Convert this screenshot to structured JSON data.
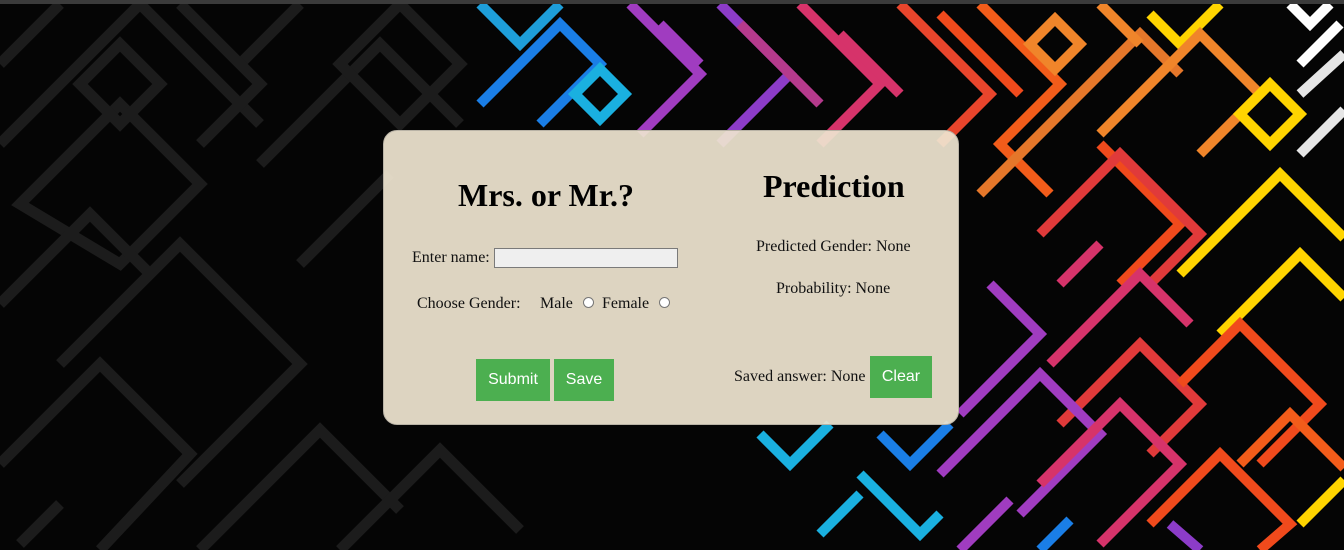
{
  "form": {
    "title": "Mrs. or Mr.?",
    "name_label": "Enter name:",
    "name_value": "",
    "gender_label": "Choose Gender:",
    "male_label": "Male",
    "female_label": "Female",
    "submit_label": "Submit",
    "save_label": "Save"
  },
  "prediction": {
    "title": "Prediction",
    "predicted_gender": "Predicted Gender: None",
    "probability": "Probability: None",
    "saved_answer": "Saved answer: None",
    "clear_label": "Clear"
  },
  "colors": {
    "button": "#4caf50",
    "card": "#eee4d0"
  }
}
